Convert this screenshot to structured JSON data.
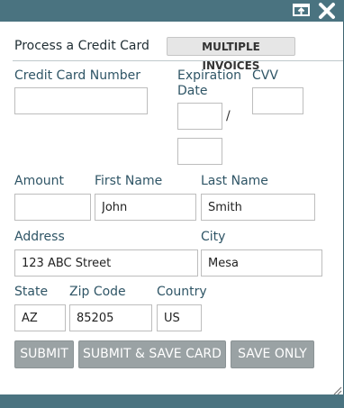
{
  "window": {
    "popout_icon": "popout-window-icon",
    "close_icon": "close-icon",
    "resize_icon": "resize-grip-icon"
  },
  "header": {
    "title": "Process a Credit Card",
    "multiple_invoices_label": "MULTIPLE INVOICES"
  },
  "form": {
    "card_number_label": "Credit Card Number",
    "card_number_value": "",
    "expiration_label_line1": "Expiration",
    "expiration_label_line2": "Date",
    "exp_month_value": "",
    "exp_separator": "/",
    "exp_year_value": "",
    "cvv_label": "CVV",
    "cvv_value": "",
    "amount_label": "Amount",
    "amount_value": "",
    "first_name_label": "First Name",
    "first_name_value": "John",
    "last_name_label": "Last Name",
    "last_name_value": "Smith",
    "address_label": "Address",
    "address_value": "123 ABC Street",
    "city_label": "City",
    "city_value": "Mesa",
    "state_label": "State",
    "state_value": "AZ",
    "zip_label": "Zip Code",
    "zip_value": "85205",
    "country_label": "Country",
    "country_value": "US"
  },
  "actions": {
    "submit_label": "SUBMIT",
    "submit_save_label": "SUBMIT & SAVE CARD",
    "save_only_label": "SAVE ONLY"
  },
  "colors": {
    "frame": "#4a7380",
    "label_text": "#2f5566",
    "button_disabled": "#9aa2a4"
  }
}
